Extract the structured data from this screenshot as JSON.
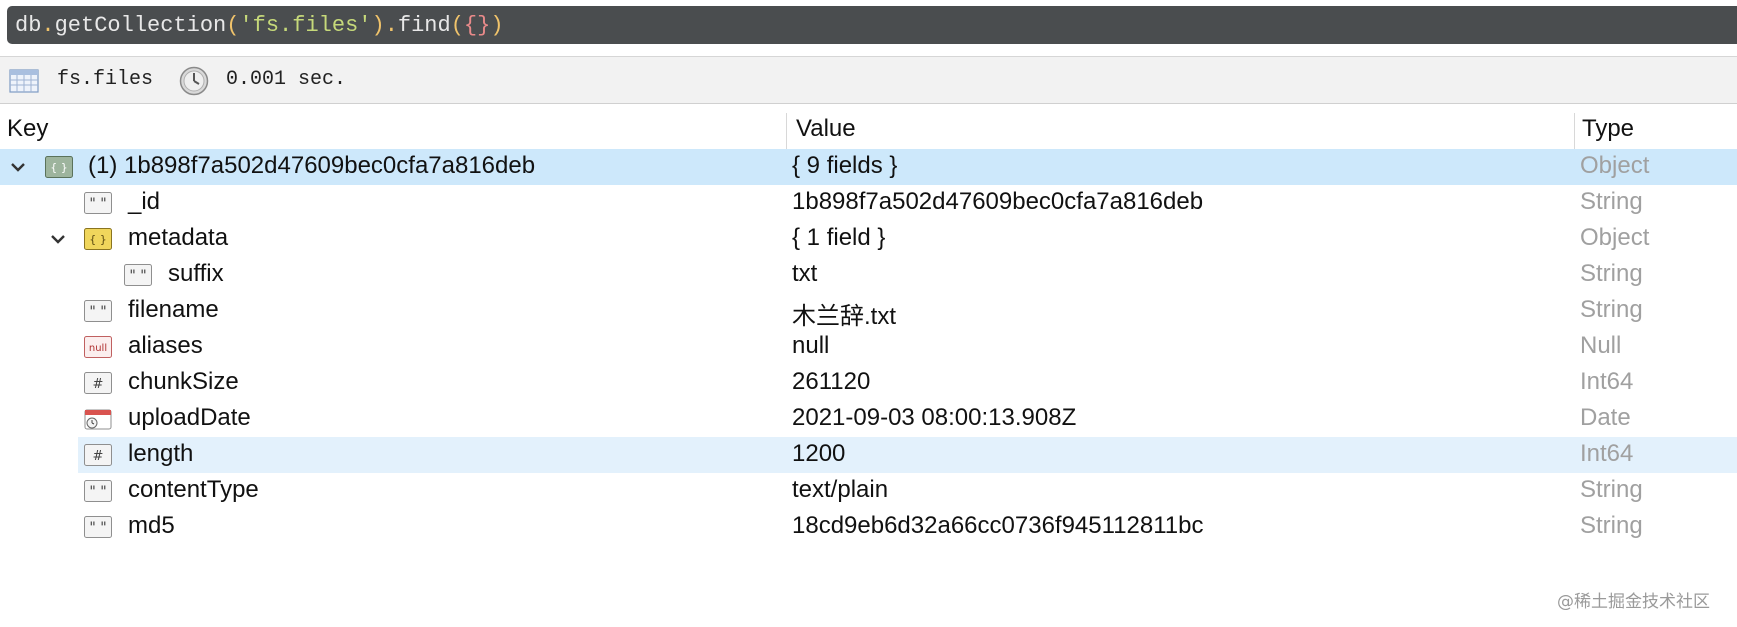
{
  "query": {
    "parts": [
      "db",
      ".",
      "getCollection",
      "(",
      "'fs.files'",
      ")",
      ".",
      "find",
      "(",
      "{",
      "}",
      ")"
    ]
  },
  "toolbar": {
    "collection": "fs.files",
    "time": "0.001 sec."
  },
  "columns": {
    "key": "Key",
    "value": "Value",
    "type": "Type"
  },
  "rows": [
    {
      "key": "(1) 1b898f7a502d47609bec0cfa7a816deb",
      "value": "{ 9 fields }",
      "type": "Object",
      "icon": "object-icon"
    },
    {
      "key": "_id",
      "value": "1b898f7a502d47609bec0cfa7a816deb",
      "type": "String",
      "icon": "string-icon"
    },
    {
      "key": "metadata",
      "value": "{ 1 field }",
      "type": "Object",
      "icon": "object-icon"
    },
    {
      "key": "suffix",
      "value": "txt",
      "type": "String",
      "icon": "string-icon"
    },
    {
      "key": "filename",
      "value": "木兰辞.txt",
      "type": "String",
      "icon": "string-icon"
    },
    {
      "key": "aliases",
      "value": "null",
      "type": "Null",
      "icon": "null-icon"
    },
    {
      "key": "chunkSize",
      "value": "261120",
      "type": "Int64",
      "icon": "number-icon"
    },
    {
      "key": "uploadDate",
      "value": "2021-09-03 08:00:13.908Z",
      "type": "Date",
      "icon": "date-icon"
    },
    {
      "key": "length",
      "value": "1200",
      "type": "Int64",
      "icon": "number-icon"
    },
    {
      "key": "contentType",
      "value": "text/plain",
      "type": "String",
      "icon": "string-icon"
    },
    {
      "key": "md5",
      "value": "18cd9eb6d32a66cc0736f945112811bc",
      "type": "String",
      "icon": "string-icon"
    }
  ],
  "watermark": "@稀土掘金技术社区",
  "colors": {
    "selected_row": "#cde8fb",
    "highlight_row": "#e3f1fc",
    "type_text": "#a0a0a0",
    "query_bg": "#4a4d4f"
  }
}
